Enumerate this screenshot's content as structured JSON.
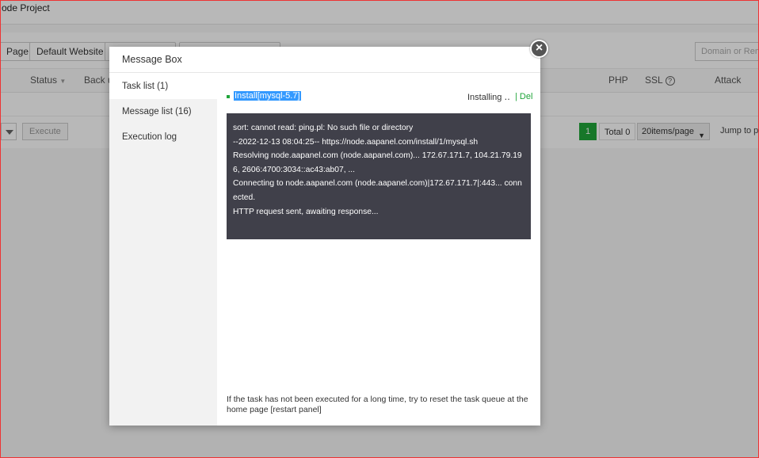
{
  "page": {
    "title": "ode Project",
    "toolbar": {
      "buttons": [
        "Page",
        "Default Website",
        "",
        ""
      ],
      "search_placeholder": "Domain or Remar"
    },
    "table_headers": {
      "status": "Status",
      "backup": "Back u",
      "php": "PHP",
      "ssl": "SSL",
      "attack": "Attack"
    },
    "footer": {
      "execute": "Execute",
      "page_current": "1",
      "total": "Total 0",
      "per_page": "20items/page",
      "jump": "Jump to pa"
    }
  },
  "modal": {
    "title": "Message Box",
    "close_symbol": "×",
    "sidebar": [
      {
        "label": "Task list (1)",
        "active": true
      },
      {
        "label": "Message list (16)",
        "active": false
      },
      {
        "label": "Execution log",
        "active": false
      }
    ],
    "task": {
      "name": "Install[mysql-5.7]",
      "status": "Installing ‥",
      "delete": "| Del"
    },
    "log_lines": [
      "sort: cannot read: ping.pl: No such file or directory",
      "--2022-12-13 08:04:25-- https://node.aapanel.com/install/1/mysql.sh",
      "Resolving node.aapanel.com (node.aapanel.com)... 172.67.171.7, 104.21.79.196, 2606:4700:3034::ac43:ab07, ...",
      "Connecting to node.aapanel.com (node.aapanel.com)|172.67.171.7|:443... connected.",
      "HTTP request sent, awaiting response..."
    ],
    "hint": "If the task has not been executed for a long time, try to reset the task queue at the home page [restart panel]"
  }
}
